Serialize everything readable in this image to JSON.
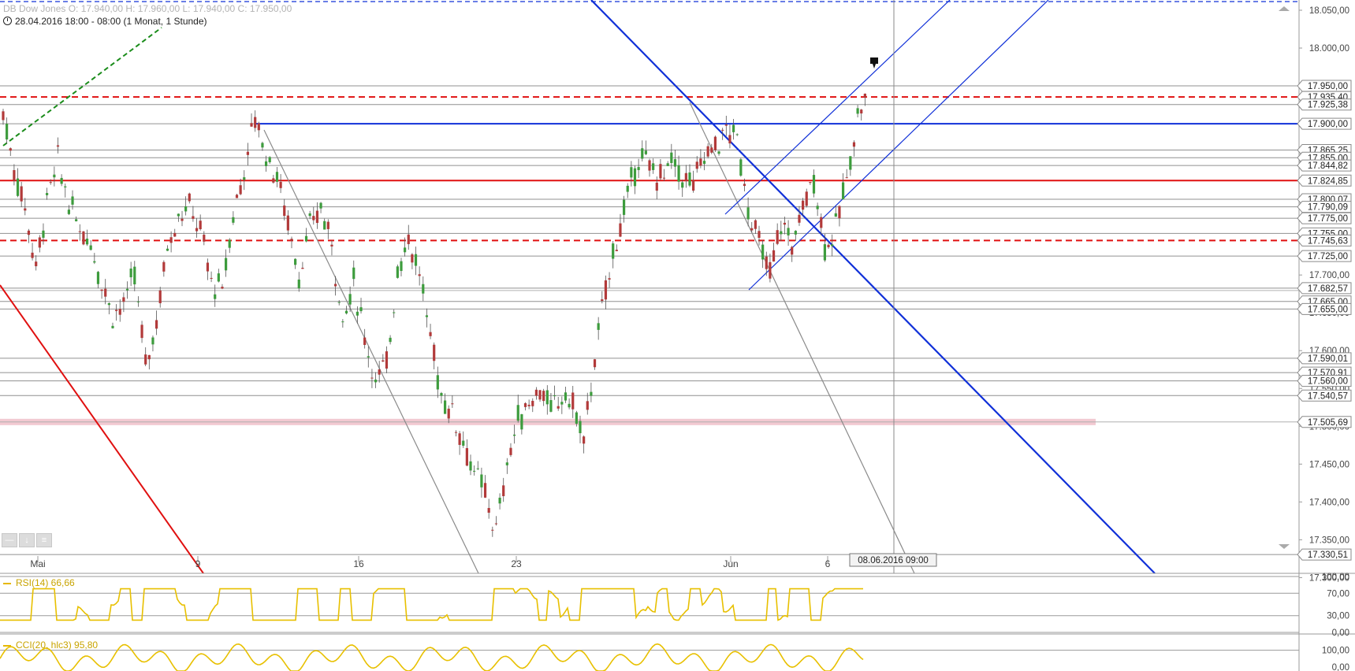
{
  "header": {
    "quote_line": "DB Dow Jones   O: 17.940,00   H: 17.960,00   L: 17.940,00   C: 17.950,00",
    "period_line": "28.04.2016 18:00 - 08:00 (1 Monat, 1 Stunde)"
  },
  "indicators": {
    "rsi_label": "RSI(14)  66,66",
    "cci_label": "CCI(20, hlc3)  95,80"
  },
  "crosshair_time_label": "08.06.2016 09:00",
  "colors": {
    "up_candle": "#3d9c3d",
    "down_candle": "#b23a3a",
    "red_line": "#e01010",
    "blue_line": "#1030d8",
    "gray_line": "#8a8a8a",
    "indicator": "#e8c000",
    "indicator_fill": "#9fd9a6"
  },
  "chart_data": {
    "type": "candlestick",
    "title": "DB Dow Jones",
    "interval": "1 Stunde",
    "range": "1 Monat",
    "ylim": [
      17300,
      18075
    ],
    "y_ticks": [
      "18.050,00",
      "18.000,00",
      "17.950,00",
      "17.900,00",
      "17.850,00",
      "17.800,00",
      "17.750,00",
      "17.700,00",
      "17.650,00",
      "17.600,00",
      "17.550,00",
      "17.500,00",
      "17.450,00",
      "17.400,00",
      "17.350,00",
      "17.300,00"
    ],
    "x_labels": [
      "Mai",
      "9",
      "16",
      "23",
      "Jun",
      "6"
    ],
    "close_path_approx": [
      [
        0,
        17915
      ],
      [
        3,
        17840
      ],
      [
        6,
        17790
      ],
      [
        9,
        17710
      ],
      [
        12,
        17800
      ],
      [
        15,
        17850
      ],
      [
        18,
        17795
      ],
      [
        21,
        17760
      ],
      [
        24,
        17745
      ],
      [
        27,
        17690
      ],
      [
        30,
        17650
      ],
      [
        33,
        17660
      ],
      [
        36,
        17700
      ],
      [
        39,
        17580
      ],
      [
        42,
        17640
      ],
      [
        45,
        17740
      ],
      [
        48,
        17780
      ],
      [
        51,
        17790
      ],
      [
        54,
        17760
      ],
      [
        57,
        17690
      ],
      [
        60,
        17680
      ],
      [
        63,
        17780
      ],
      [
        66,
        17840
      ],
      [
        69,
        17910
      ],
      [
        72,
        17860
      ],
      [
        75,
        17830
      ],
      [
        78,
        17770
      ],
      [
        81,
        17700
      ],
      [
        84,
        17760
      ],
      [
        87,
        17790
      ],
      [
        90,
        17740
      ],
      [
        93,
        17640
      ],
      [
        96,
        17690
      ],
      [
        99,
        17620
      ],
      [
        102,
        17560
      ],
      [
        105,
        17580
      ],
      [
        108,
        17710
      ],
      [
        111,
        17750
      ],
      [
        114,
        17700
      ],
      [
        117,
        17620
      ],
      [
        120,
        17540
      ],
      [
        123,
        17520
      ],
      [
        126,
        17480
      ],
      [
        129,
        17440
      ],
      [
        132,
        17410
      ],
      [
        135,
        17360
      ],
      [
        138,
        17450
      ],
      [
        141,
        17510
      ],
      [
        144,
        17530
      ],
      [
        147,
        17550
      ],
      [
        150,
        17520
      ],
      [
        153,
        17540
      ],
      [
        156,
        17530
      ],
      [
        159,
        17480
      ],
      [
        162,
        17590
      ],
      [
        165,
        17680
      ],
      [
        168,
        17750
      ],
      [
        171,
        17800
      ],
      [
        174,
        17860
      ],
      [
        177,
        17840
      ],
      [
        180,
        17830
      ],
      [
        183,
        17850
      ],
      [
        186,
        17830
      ],
      [
        189,
        17820
      ],
      [
        192,
        17860
      ],
      [
        195,
        17870
      ],
      [
        198,
        17890
      ],
      [
        201,
        17880
      ],
      [
        204,
        17790
      ],
      [
        207,
        17740
      ],
      [
        210,
        17700
      ],
      [
        213,
        17770
      ],
      [
        216,
        17740
      ],
      [
        219,
        17790
      ],
      [
        222,
        17830
      ],
      [
        225,
        17740
      ],
      [
        228,
        17760
      ],
      [
        231,
        17830
      ],
      [
        234,
        17910
      ],
      [
        237,
        17950
      ]
    ],
    "horizontal_levels": [
      {
        "label": "17.950,00",
        "value": 17950.0,
        "style": "gray"
      },
      {
        "label": "17.935,40",
        "value": 17935.4,
        "style": "red-dashed"
      },
      {
        "label": "17.925,38",
        "value": 17925.38,
        "style": "gray"
      },
      {
        "label": "17.900,00",
        "value": 17900.0,
        "style": "blue"
      },
      {
        "label": "17.865,25",
        "value": 17865.25,
        "style": "gray"
      },
      {
        "label": "17.855,00",
        "value": 17855.0,
        "style": "gray"
      },
      {
        "label": "17.844,82",
        "value": 17844.82,
        "style": "gray"
      },
      {
        "label": "17.824,85",
        "value": 17824.85,
        "style": "red"
      },
      {
        "label": "17.800,07",
        "value": 17800.07,
        "style": "gray"
      },
      {
        "label": "17.790,09",
        "value": 17790.09,
        "style": "gray"
      },
      {
        "label": "17.775,00",
        "value": 17775.0,
        "style": "gray"
      },
      {
        "label": "17.755,00",
        "value": 17755.0,
        "style": "gray"
      },
      {
        "label": "17.745,63",
        "value": 17745.63,
        "style": "red-dashed"
      },
      {
        "label": "17.725,00",
        "value": 17725.0,
        "style": "gray"
      },
      {
        "label": "17.682,57",
        "value": 17682.57,
        "style": "gray-double"
      },
      {
        "label": "17.665,00",
        "value": 17665.0,
        "style": "gray"
      },
      {
        "label": "17.655,00",
        "value": 17655.0,
        "style": "gray"
      },
      {
        "label": "17.590,01",
        "value": 17590.01,
        "style": "gray"
      },
      {
        "label": "17.570,91",
        "value": 17570.91,
        "style": "gray"
      },
      {
        "label": "17.560,00",
        "value": 17560.0,
        "style": "gray"
      },
      {
        "label": "17.540,57",
        "value": 17540.57,
        "style": "gray"
      },
      {
        "label": "17.505,69",
        "value": 17505.69,
        "style": "pink-band"
      },
      {
        "label": "17.330,51",
        "value": 17330.51,
        "style": "gray"
      }
    ],
    "rsi": {
      "name": "RSI(14)",
      "value": 66.66,
      "levels": [
        "100,00",
        "70,00",
        "30,00",
        "0,00"
      ]
    },
    "cci": {
      "name": "CCI(20, hlc3)",
      "value": 95.8,
      "levels": [
        "100,00",
        "0,00"
      ]
    }
  }
}
